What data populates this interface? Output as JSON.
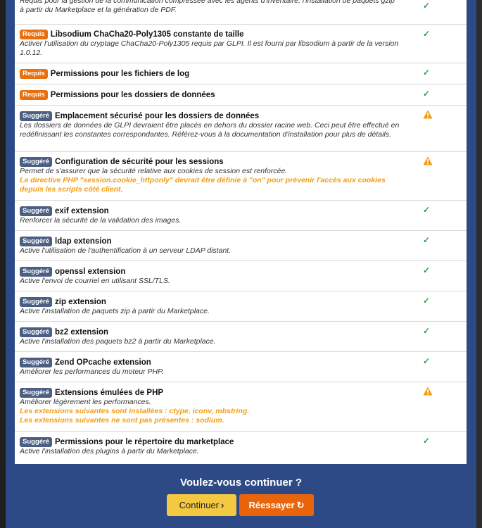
{
  "colors": {
    "required": "#e8700f",
    "suggested": "#4b5e83",
    "ok": "#2e9e44",
    "warning": "#f39c12",
    "footer_bg": "#2d4a86"
  },
  "partial_row": {
    "desc1": "Requis pour la gestion de la communication compressée avec les agents d'inventaire, l'installation de paquets gzip",
    "desc2": "à partir du Marketplace et la génération de PDF.",
    "status": "check-icon"
  },
  "rows": [
    {
      "badge": "Requis",
      "title": "Libsodium ChaCha20-Poly1305 constante de taille",
      "desc": "Activer l'utilisation du cryptage ChaCha20-Poly1305 requis par GLPI. Il est fourni par libsodium à partir de la version 1.0.12.",
      "warn": "",
      "status": "check-icon"
    },
    {
      "badge": "Requis",
      "title": "Permissions pour les fichiers de log",
      "desc": "",
      "warn": "",
      "status": "check-icon"
    },
    {
      "badge": "Requis",
      "title": "Permissions pour les dossiers de données",
      "desc": "",
      "warn": "",
      "status": "check-icon"
    },
    {
      "badge": "Suggéré",
      "title": "Emplacement sécurisé pour les dossiers de données",
      "desc": "Les dossiers de données de GLPI devraient être placés en dehors du dossier racine web. Ceci peut être effectué en redéfinissant les constantes correspondantes. Référez-vous à la documentation d'installation pour plus de détails.",
      "warn": "",
      "status": "warning-icon"
    },
    {
      "badge": "Suggéré",
      "title": "Configuration de sécurité pour les sessions",
      "desc": "Permet de s'assurer que la sécurité relative aux cookies de session est renforcée.",
      "warn": "La directive PHP \"session.cookie_httponly\" devrait être définie à \"on\" pour prévenir l'accès aux cookies depuis les scripts côté client.",
      "status": "warning-icon"
    },
    {
      "badge": "Suggéré",
      "title": "exif extension",
      "desc": "Renforcer la sécurité de la validation des images.",
      "warn": "",
      "status": "check-icon"
    },
    {
      "badge": "Suggéré",
      "title": "ldap extension",
      "desc": "Active l'utilisation de l'authentification à un serveur LDAP distant.",
      "warn": "",
      "status": "check-icon"
    },
    {
      "badge": "Suggéré",
      "title": "openssl extension",
      "desc": "Active l'envoi de courriel en utilisant SSL/TLS.",
      "warn": "",
      "status": "check-icon"
    },
    {
      "badge": "Suggéré",
      "title": "zip extension",
      "desc": "Active l'installation de paquets zip à partir du Marketplace.",
      "warn": "",
      "status": "check-icon"
    },
    {
      "badge": "Suggéré",
      "title": "bz2 extension",
      "desc": "Active l'installation des paquets bz2 à partir du Marketplace.",
      "warn": "",
      "status": "check-icon"
    },
    {
      "badge": "Suggéré",
      "title": "Zend OPcache extension",
      "desc": "Améliorer les performances du moteur PHP.",
      "warn": "",
      "status": "check-icon"
    },
    {
      "badge": "Suggéré",
      "title": "Extensions émulées de PHP",
      "desc": "Améliorer légèrement les performances.",
      "warn": "Les extensions suivantes sont installées : ctype, iconv, mbstring.\nLes extensions suivantes ne sont pas présentes : sodium.",
      "status": "warning-icon"
    },
    {
      "badge": "Suggéré",
      "title": "Permissions pour le répertoire du marketplace",
      "desc": "Active l'installation des plugins à partir du Marketplace.",
      "warn": "",
      "status": "check-icon"
    }
  ],
  "footer": {
    "question": "Voulez-vous continuer ?",
    "continue_label": "Continuer",
    "retry_label": "Réessayer"
  }
}
